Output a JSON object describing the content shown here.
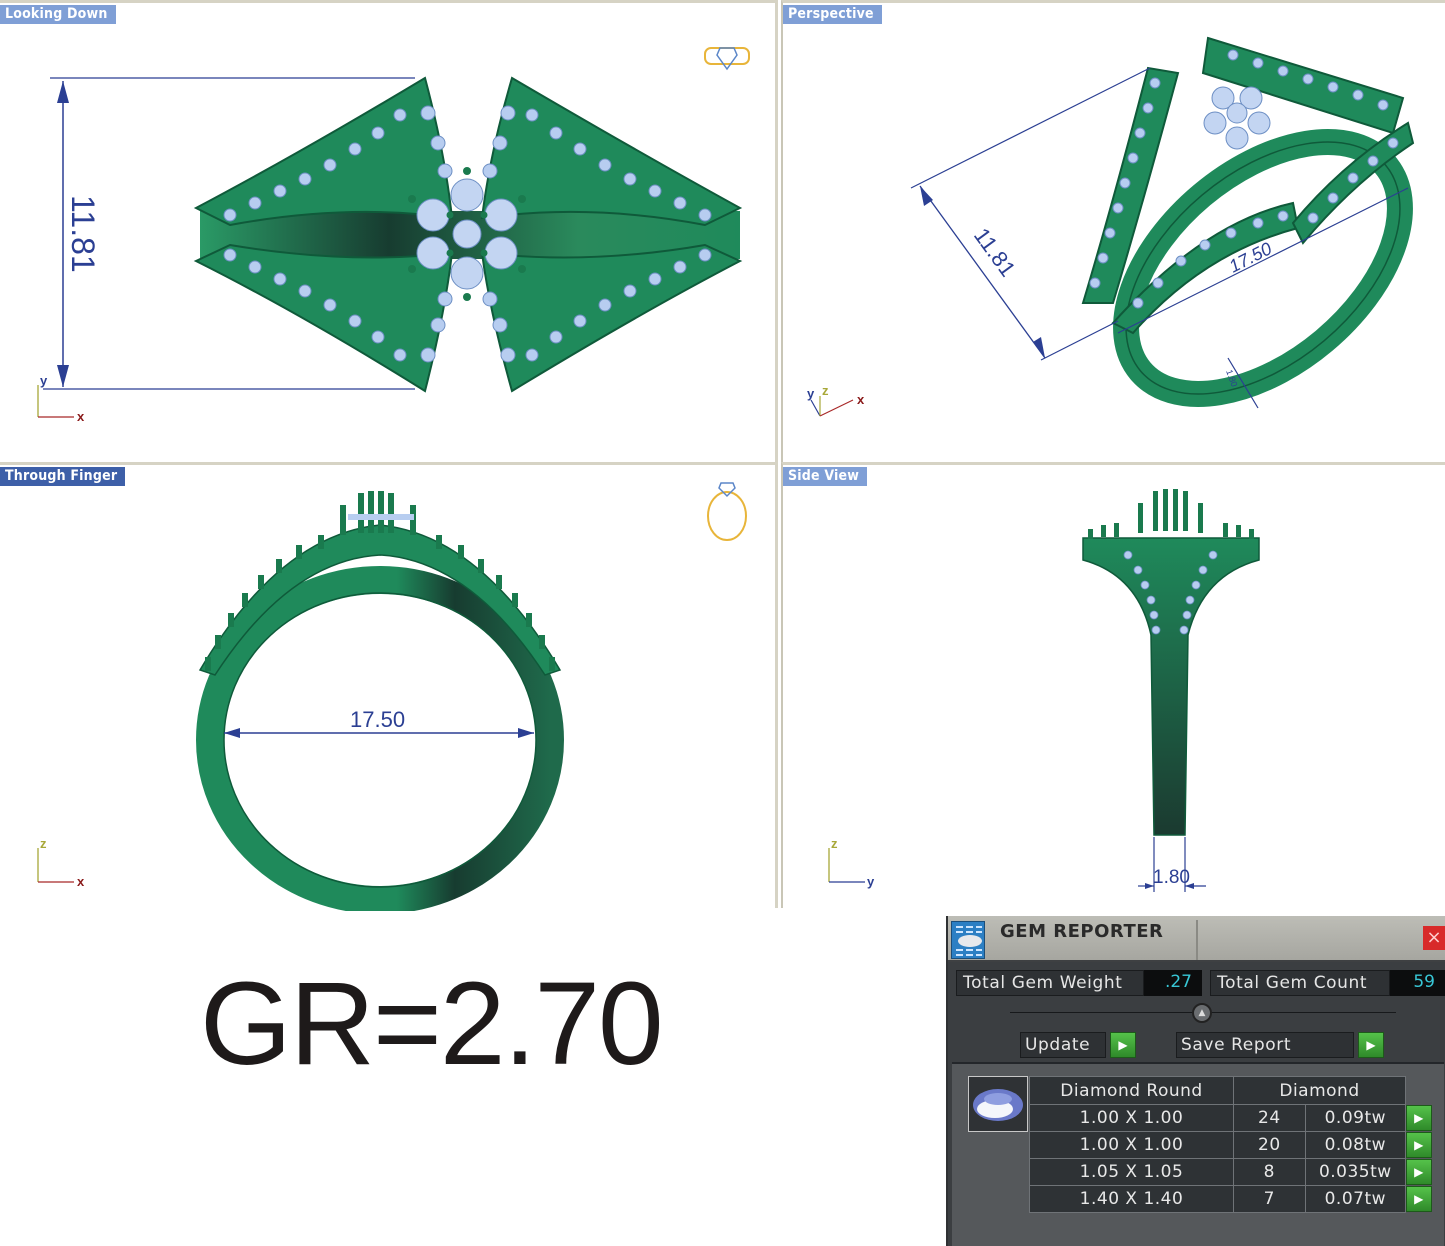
{
  "viewports": {
    "top": {
      "label": "Looking Down",
      "dimension": "11.81",
      "axes": {
        "vertical": "y",
        "horizontal": "x"
      },
      "orientation_icon": "ring-top-view-icon"
    },
    "perspective": {
      "label": "Perspective",
      "dimension_height": "11.81",
      "dimension_diameter": "17.50",
      "dimension_width": "1.80",
      "axes": {
        "a": "y",
        "b": "z",
        "c": "x"
      }
    },
    "front": {
      "label": "Through Finger",
      "dimension": "17.50",
      "axes": {
        "vertical": "z",
        "horizontal": "x"
      },
      "orientation_icon": "ring-front-view-icon"
    },
    "side": {
      "label": "Side View",
      "dimension": "1.80",
      "axes": {
        "vertical": "z",
        "horizontal": "y"
      }
    }
  },
  "gr_label": "GR=2.70",
  "gem_reporter": {
    "title": "GEM REPORTER",
    "close_icon": "×",
    "total_weight_label": "Total Gem Weight",
    "total_weight_value": ".27",
    "total_count_label": "Total Gem Count",
    "total_count_value": "59",
    "collapse_icon": "▲",
    "update_label": "Update",
    "save_report_label": "Save Report",
    "play_icon": "▶",
    "table": {
      "header_shape": "Diamond Round",
      "header_material": "Diamond",
      "rows": [
        {
          "size": "1.00 X 1.00",
          "count": "24",
          "weight": "0.09tw"
        },
        {
          "size": "1.00 X 1.00",
          "count": "20",
          "weight": "0.08tw"
        },
        {
          "size": "1.05 X 1.05",
          "count": "8",
          "weight": "0.035tw"
        },
        {
          "size": "1.40 X 1.40",
          "count": "7",
          "weight": "0.07tw"
        }
      ]
    }
  },
  "colors": {
    "metal": "#1f8a5b",
    "metal_dark": "#123f2f",
    "stone": "#b7cdf0",
    "dimension": "#2b3f93",
    "label_bg": "#7f9fd6",
    "value_cyan": "#38c7d6"
  }
}
